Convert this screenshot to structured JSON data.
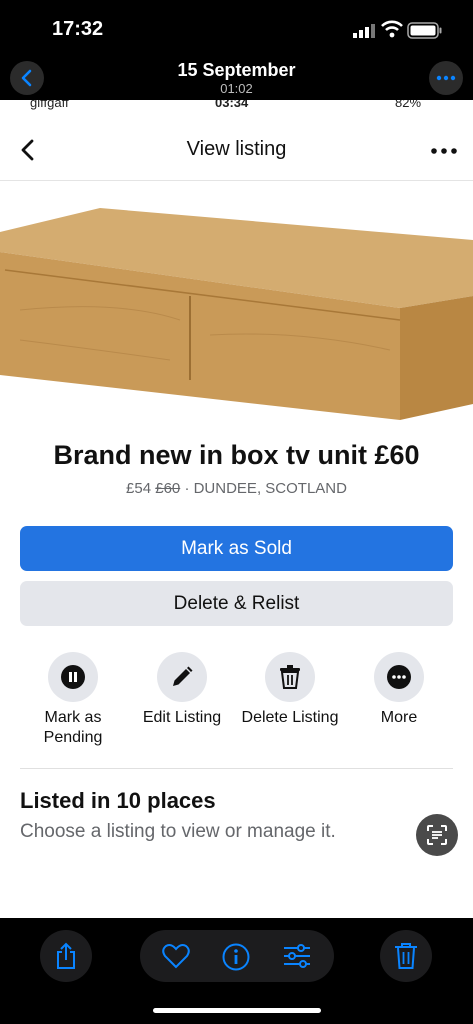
{
  "status_bar": {
    "time": "17:32"
  },
  "photo_header": {
    "date": "15 September",
    "duration": "01:02"
  },
  "inner_status": {
    "carrier": "giffgaff",
    "time": "03:34",
    "battery": "82%"
  },
  "nav": {
    "title": "View listing"
  },
  "listing": {
    "title": "Brand new in box tv unit £60",
    "price": "£54",
    "old_price": "£60",
    "location": "· DUNDEE, SCOTLAND"
  },
  "buttons": {
    "mark_sold": "Mark as Sold",
    "delete_relist": "Delete & Relist"
  },
  "actions": [
    {
      "label": "Mark as Pending",
      "icon": "pause-icon"
    },
    {
      "label": "Edit Listing",
      "icon": "pencil-icon"
    },
    {
      "label": "Delete Listing",
      "icon": "trash-icon"
    },
    {
      "label": "More",
      "icon": "more-icon"
    }
  ],
  "places": {
    "title": "Listed in 10 places",
    "subtitle": "Choose a listing to view or manage it."
  },
  "colors": {
    "accent": "#2374e1",
    "ios_blue": "#0a84ff",
    "secondary_button": "#e4e6eb",
    "wood": "#c89a5a"
  },
  "toolbar": [
    "share-icon",
    "heart-icon",
    "info-icon",
    "adjust-icon",
    "trash-icon"
  ]
}
